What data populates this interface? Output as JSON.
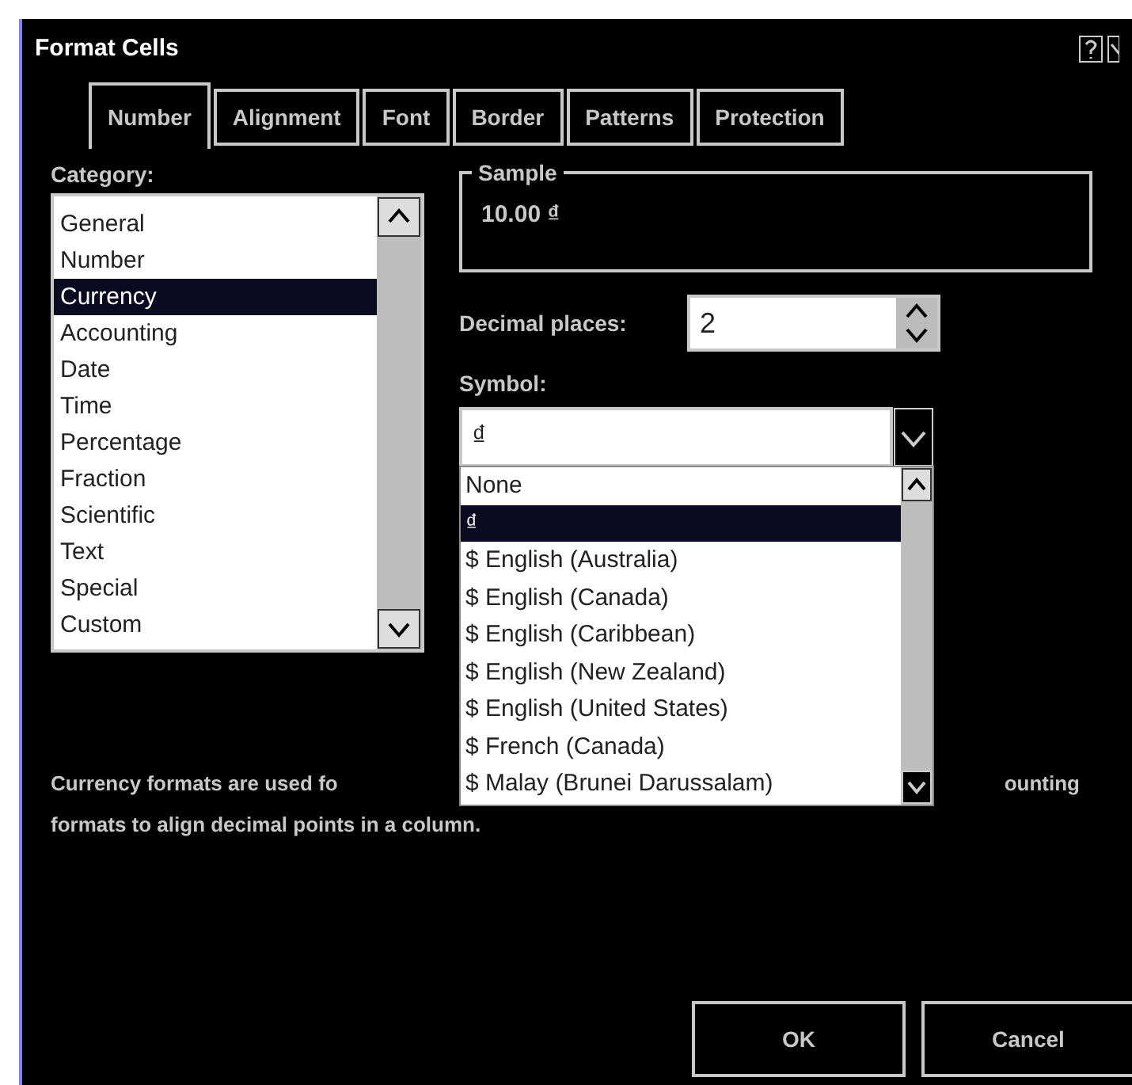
{
  "window": {
    "title": "Format Cells"
  },
  "tabs": [
    {
      "label": "Number",
      "selected": true
    },
    {
      "label": "Alignment",
      "selected": false
    },
    {
      "label": "Font",
      "selected": false
    },
    {
      "label": "Border",
      "selected": false
    },
    {
      "label": "Patterns",
      "selected": false
    },
    {
      "label": "Protection",
      "selected": false
    }
  ],
  "category": {
    "label": "Category:",
    "items": [
      {
        "label": "General",
        "selected": false
      },
      {
        "label": "Number",
        "selected": false
      },
      {
        "label": "Currency",
        "selected": true
      },
      {
        "label": "Accounting",
        "selected": false
      },
      {
        "label": "Date",
        "selected": false
      },
      {
        "label": "Time",
        "selected": false
      },
      {
        "label": "Percentage",
        "selected": false
      },
      {
        "label": "Fraction",
        "selected": false
      },
      {
        "label": "Scientific",
        "selected": false
      },
      {
        "label": "Text",
        "selected": false
      },
      {
        "label": "Special",
        "selected": false
      },
      {
        "label": "Custom",
        "selected": false
      }
    ]
  },
  "sample": {
    "label": "Sample",
    "value": "10.00 ₫"
  },
  "decimal_places": {
    "label": "Decimal places:",
    "value": "2"
  },
  "symbol": {
    "label": "Symbol:",
    "value": "₫",
    "options": [
      {
        "label": "None",
        "selected": false
      },
      {
        "label": "₫",
        "selected": true
      },
      {
        "label": "$ English (Australia)",
        "selected": false
      },
      {
        "label": "$ English (Canada)",
        "selected": false
      },
      {
        "label": "$ English (Caribbean)",
        "selected": false
      },
      {
        "label": "$ English (New Zealand)",
        "selected": false
      },
      {
        "label": "$ English (United States)",
        "selected": false
      },
      {
        "label": "$ French (Canada)",
        "selected": false
      },
      {
        "label": "$ Malay (Brunei Darussalam)",
        "selected": false
      }
    ]
  },
  "description": {
    "line_1_left": "Currency formats are used fo",
    "line_1_right": "ounting",
    "line_2": "formats to align decimal points in a column."
  },
  "buttons": [
    {
      "label": "OK"
    },
    {
      "label": "Cancel"
    }
  ]
}
